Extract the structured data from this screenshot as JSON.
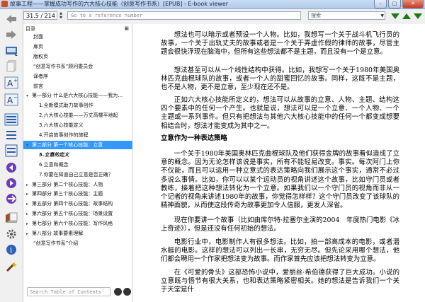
{
  "window": {
    "title": "故事工程——掌握成功写作的六大核心技能（创意写作书系）[EPUB] - E-book viewer",
    "buttons": {
      "minimize": "–",
      "maximize": "□",
      "close": "✕"
    }
  },
  "topbar": {
    "page_position": "31.5 / 214",
    "reference_placeholder": "Go to a reference number",
    "search_label": "搜索"
  },
  "toolbar": {
    "icons": [
      "back-arrow-icon",
      "forward-arrow-icon",
      "library-icon",
      "copy-icon",
      "font-larger-icon",
      "font-smaller-icon",
      "toc-toggle-icon",
      "previous-section-icon",
      "next-section-icon",
      "search-icon",
      "bookmark-icon",
      "reference-mode-icon",
      "preferences-icon",
      "print-icon",
      "metadata-icon"
    ]
  },
  "toc": {
    "header": "目录",
    "items": [
      {
        "label": "封面",
        "level": 1
      },
      {
        "label": "扉页",
        "level": 1
      },
      {
        "label": "版权页",
        "level": 1
      },
      {
        "label": "“创意写作书系”顾问委员会",
        "level": 1
      },
      {
        "label": "译者序",
        "level": 1
      },
      {
        "label": "前言",
        "level": 1
      },
      {
        "label": "第一部分 什么是六大核心技能——我为…",
        "level": 0
      },
      {
        "label": "1.全新模式助力故事创作",
        "level": 2
      },
      {
        "label": "2.六大核心技能——万丈高楼平地起",
        "level": 2
      },
      {
        "label": "3.六大核心技能定义",
        "level": 2
      },
      {
        "label": "4.开启故事创作的旅程",
        "level": 2
      },
      {
        "label": "第二部分 第一个核心技能：立意",
        "level": 0
      },
      {
        "label": "5.立意的定义",
        "level": 2
      },
      {
        "label": "6.立意和概念",
        "level": 2
      },
      {
        "label": "7.你要在知道自己立意是否正确？",
        "level": 2
      },
      {
        "label": "第三部分 第二个核心技能：人物",
        "level": 0
      },
      {
        "label": "第四部分 第三个核心技能：主题",
        "level": 0
      },
      {
        "label": "第五部分 第四个核心技能：故事结构",
        "level": 0
      },
      {
        "label": "第六部分 第五个核心技能：场景设置",
        "level": 0
      },
      {
        "label": "第七部分 第六个核心技能：写作风格",
        "level": 0
      },
      {
        "label": "第八部分 故事要素理解",
        "level": 0
      },
      {
        "label": "“创意写作书系”介绍",
        "level": 1
      }
    ],
    "selected_index": 11,
    "search_placeholder": "Search Table of Contents"
  },
  "content": {
    "paragraphs": [
      "想法也可以暗示或者预设一个人物。比如，我想写一个关于战斗机飞行员的故事，一个关于出轨丈夫的故事或者是一个关于弄虚作假的律师的故事，尽管主题会很快浮现在脑海中，但所有这些想法都不是主题，而且没有一个是立意。",
      "想法甚至可以从一个线性结构中获得。比如，我想写一个关于1980年美国奥林匹克曲棍球队的故事，或者一个人的甜蜜回忆的故事。同样，这既不是主题，也不是人物，更不是立意，至少现在还不是。",
      "正如六大核心技能所定义的，想法可以从故事的立意、人物、主题、结构这四个要素中的任何一个产生。也就是说，想法可以是一个立意、一个人物、一个主题或一系列事件。但只有把想法与其他六大核心技能中的任何一个都变成想要相结合时，想法才能变成为其中之一。",
      "一个关于1980年美国奥林匹克曲棍球队及他们获得金牌的故事看似造成了立意的概念。因为无论怎样该说是事实，所有不能轻易改变。事实。每次阿门上你不仅能，而且可以运用一种立意式的表达策略向我们展示这个事实，通常不必过多说么事情。比如，你可以以某个运动员的视角讲述这个故事，比如守门员或者教练，接着把这种想法转化为一个立意。如果我们以一个守门员的视角而非从一个记者的视角来讲述1980年的故事，你觉得怎样样？这个守门员改变了该球队的精神面貌，从而使这段传奇为故事更加令人信服，更发人深省。",
      "现在你要讲一个故事（比如由库尔特·拉塞尔主演的2004　年度热门电影《冰上奇迹》），但是还没有任何初始的想法。",
      "电影行业中，电影制作人有很多想法。比如，拍一部高成本的电影，或者潜水艇的电影。这样的想法可以列出一长串，无穷无尽。但先论采用哪个想法，他们都会聘用一个作家把想法变为故事。而作家首先应该把想法转变为立意。",
      "在《可爱的骨头》这部恐怖小说中，爱丽丝·希伯德获得了巨大成功。小说的立意既与悟节有很大关系，也和表达策略紧密相关。她的想法是告诉我们一个关于天堂是什"
    ],
    "heading": "立意作为一种表达策略"
  }
}
